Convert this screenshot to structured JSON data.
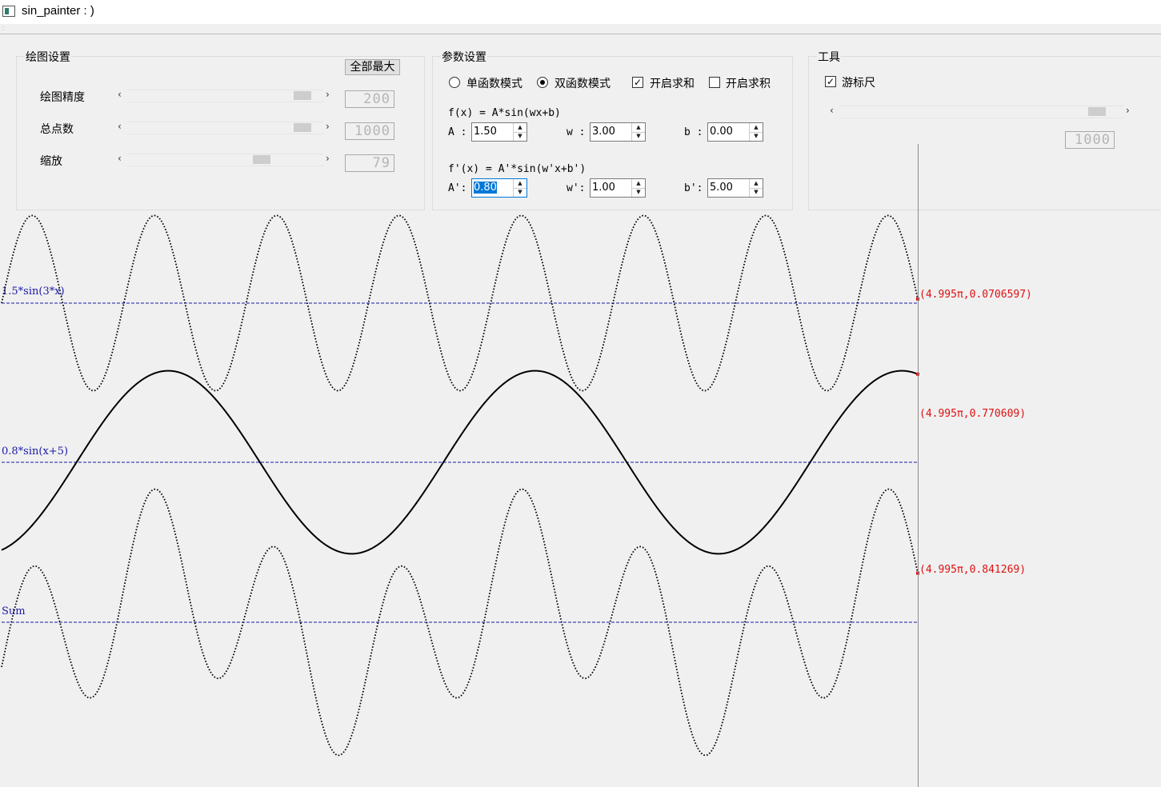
{
  "window": {
    "title": "sin_painter : )"
  },
  "draw_settings": {
    "title": "绘图设置",
    "max_all_button": "全部最大",
    "rows": [
      {
        "label": "绘图精度",
        "value": "200",
        "level": 0.93
      },
      {
        "label": "总点数",
        "value": "1000",
        "level": 0.93
      },
      {
        "label": "缩放",
        "value": "79",
        "level": 0.7
      }
    ]
  },
  "param_settings": {
    "title": "参数设置",
    "mode_single": "单函数模式",
    "mode_double": "双函数模式",
    "mode_selected": "double",
    "enable_sum": "开启求和",
    "enable_sum_checked": true,
    "enable_product": "开启求积",
    "enable_product_checked": false,
    "f_formula": "f(x) = A*sin(wx+b)",
    "f_params": [
      {
        "label": "A :",
        "value": "1.50"
      },
      {
        "label": "w :",
        "value": "3.00"
      },
      {
        "label": "b :",
        "value": "0.00"
      }
    ],
    "g_formula": "f'(x) = A'*sin(w'x+b')",
    "g_params": [
      {
        "label": "A':",
        "value": "0.80"
      },
      {
        "label": "w':",
        "value": "1.00"
      },
      {
        "label": "b':",
        "value": "5.00"
      }
    ]
  },
  "tools": {
    "title": "工具",
    "cursor_ruler": "游标尺",
    "cursor_ruler_checked": true,
    "cursor_value": "1000",
    "cursor_level": 0.93
  },
  "plot": {
    "colors": {
      "curve": "#000000",
      "axis": "#1a1aa6",
      "label": "#1a1aa6",
      "readout": "#dd1111",
      "cursor": "#8a8a8a"
    },
    "x_span_pi": 4.995,
    "curves": [
      {
        "label": "1.5*sin(3*x)",
        "A": 1.5,
        "w": 3,
        "b": 0,
        "style": "dotted",
        "readout": "(4.995π,0.0706597)"
      },
      {
        "label": "0.8*sin(x+5)",
        "A": 0.8,
        "w": 1,
        "b": 5,
        "style": "solid",
        "readout": "(4.995π,0.770609)"
      },
      {
        "label": "Sum",
        "sum": true,
        "style": "dotted",
        "readout": "(4.995π,0.841269)"
      }
    ]
  }
}
